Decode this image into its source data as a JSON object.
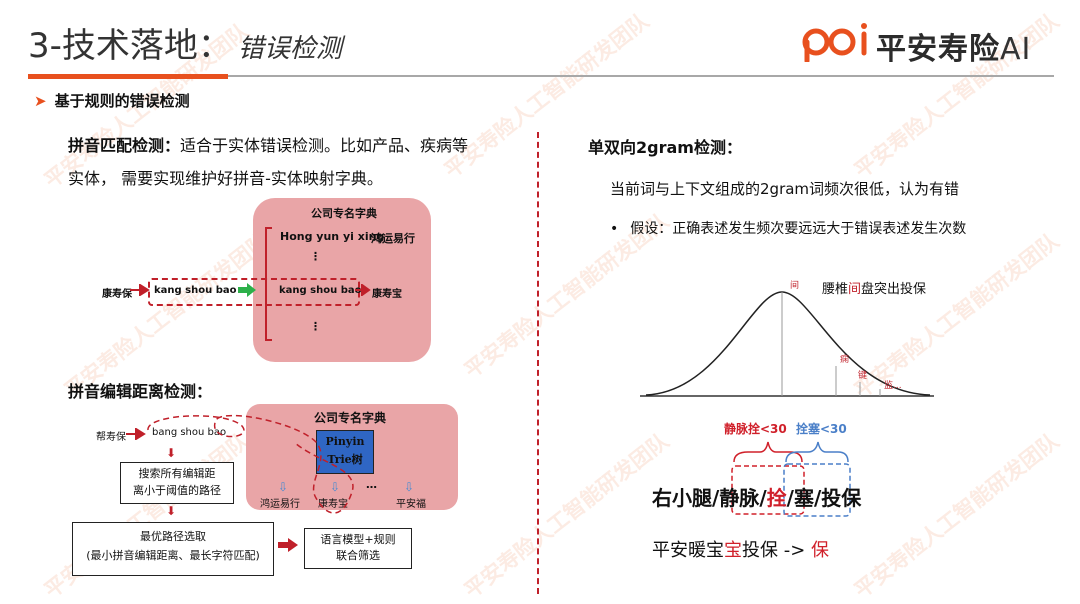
{
  "header": {
    "title": "3-技术落地：",
    "subtitle": "错误检测",
    "logo_mark": "poi",
    "logo_text": "平安寿险",
    "logo_ai": "AI",
    "watermark": "平安寿险人工智能研发团队"
  },
  "section": {
    "label": "基于规则的错误检测"
  },
  "left": {
    "pinyin_match": {
      "heading": "拼音匹配检测：",
      "desc_line1": "适合于实体错误检测。比如产品、疾病等",
      "desc_line2": "实体， 需要实现维护好拼音-实体映射字典。",
      "dict_title": "公司专名字典",
      "dict_row1_pinyin": "Hong yun yi xing",
      "dict_row1_entity": "鸿运易行",
      "ellipsis": "⋮",
      "input_word": "康寿保",
      "input_pinyin": "kang shou bao",
      "match_pinyin": "kang shou bao",
      "match_entity": "康寿宝"
    },
    "edit_distance": {
      "heading": "拼音编辑距离检测：",
      "dict_title": "公司专名字典",
      "trie_line1": "Pinyin",
      "trie_line2": "Trie树",
      "input_word": "帮寿保",
      "input_pinyin": "bang shou bao",
      "search_box_line1": "搜索所有编辑距",
      "search_box_line2": "离小于阈值的路径",
      "best_line1": "最优路径选取",
      "best_line2": "(最小拼音编辑距离、最长字符匹配)",
      "lm_line1": "语言模型+规则",
      "lm_line2": "联合筛选",
      "cand1": "鸿运易行",
      "cand2": "康寿宝",
      "cand_ellipsis": "…",
      "cand3": "平安福"
    }
  },
  "right": {
    "heading": "单双向2gram检测：",
    "desc": "当前词与上下文组成的2gram词频次很低，认为有错",
    "bullet_dot": "•",
    "assumption": "假设：正确表述发生频次要远远大于错误表述发生次数",
    "curve_label_prefix": "腰椎",
    "curve_label_highlight": "间",
    "curve_label_suffix": "盘突出投保",
    "peak_char": "间",
    "tail_char1": "痫",
    "tail_char2": "键",
    "tail_char3": "监...",
    "count_red": "静脉拴<30",
    "count_blue": "拴塞<30",
    "sentence": [
      "右小腿",
      "/",
      "静脉",
      "/",
      "拴",
      "/",
      "塞",
      "/",
      "投保"
    ],
    "bottom_prefix": "平安暖宝",
    "bottom_err": "宝",
    "bottom_mid": "投保 -> ",
    "bottom_fix": "保"
  },
  "colors": {
    "accent": "#e8501e",
    "red": "#d0202a",
    "blue": "#4a7fc8",
    "pink": "#e9a5a7"
  }
}
